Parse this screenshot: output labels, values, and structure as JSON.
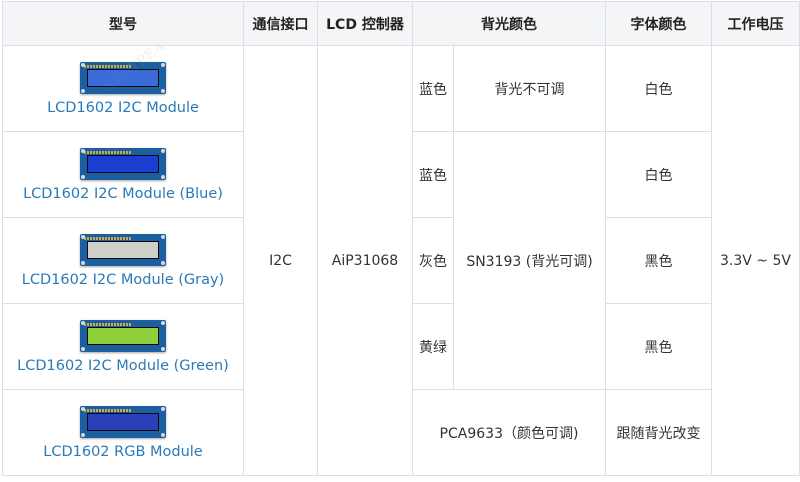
{
  "table": {
    "headers": [
      "型号",
      "通信接口",
      "LCD 控制器",
      "背光颜色",
      "字体颜色",
      "工作电压"
    ],
    "rows": [
      {
        "model": "LCD1602 I2C Module",
        "screen_color": "#3a6bd8",
        "backlight_color": "蓝色",
        "backlight_ctrl": "背光不可调",
        "font_color": "白色"
      },
      {
        "model": "LCD1602 I2C Module (Blue)",
        "screen_color": "#1c3ed0",
        "backlight_color": "蓝色",
        "font_color": "白色"
      },
      {
        "model": "LCD1602 I2C Module (Gray)",
        "screen_color": "#cdd0c8",
        "backlight_color": "灰色",
        "font_color": "黑色"
      },
      {
        "model": "LCD1602 I2C Module (Green)",
        "screen_color": "#8fcf3a",
        "backlight_color": "黄绿",
        "font_color": "黑色"
      },
      {
        "model": "LCD1602 RGB Module",
        "screen_color": "#2a3fb8",
        "font_color": "跟随背光改变"
      }
    ],
    "interface": "I2C",
    "controller": "AiP31068",
    "backlight_driver_adjustable": "SN3193 (背光可调)",
    "rgb_backlight_driver": "PCA9633（颜色可调)",
    "voltage": "3.3V ~ 5V"
  },
  "colors": {
    "link": "#2a7ab8",
    "header_bg": "#f4f5f7",
    "border": "#dcdfe6",
    "pcb": "#1b5fa0"
  },
  "watermark": "SPOTPEAR"
}
